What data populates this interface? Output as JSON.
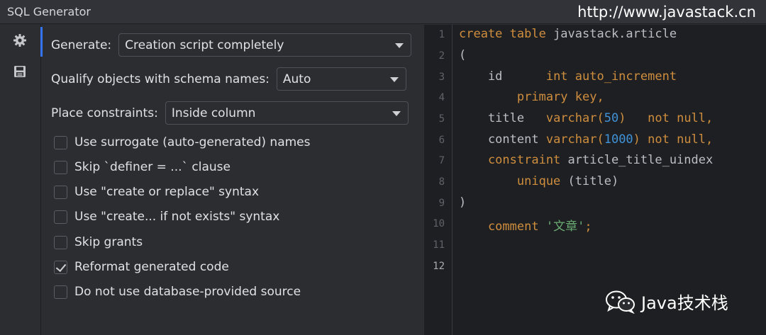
{
  "window": {
    "title": "SQL Generator"
  },
  "watermark": {
    "url": "http://www.javastack.cn",
    "wechat": "Java技术栈"
  },
  "toolstrip": {
    "items": [
      {
        "icon": "gear-icon"
      },
      {
        "icon": "save-icon"
      }
    ]
  },
  "settings": {
    "generate": {
      "label": "Generate:",
      "value": "Creation script completely"
    },
    "qualify": {
      "label": "Qualify objects with schema names:",
      "value": "Auto"
    },
    "constraints": {
      "label": "Place constraints:",
      "value": "Inside column"
    },
    "options": [
      {
        "label": "Use surrogate (auto-generated) names",
        "checked": false
      },
      {
        "label": "Skip `definer = ...` clause",
        "checked": false
      },
      {
        "label": "Use \"create or replace\" syntax",
        "checked": false
      },
      {
        "label": "Use \"create... if not exists\" syntax",
        "checked": false
      },
      {
        "label": "Skip grants",
        "checked": false
      },
      {
        "label": "Reformat generated code",
        "checked": true
      },
      {
        "label": "Do not use database-provided source",
        "checked": false
      }
    ]
  },
  "editor": {
    "line_numbers": [
      "1",
      "2",
      "3",
      "4",
      "5",
      "6",
      "7",
      "8",
      "9",
      "10",
      "11",
      "12"
    ],
    "current_line": "12",
    "code": {
      "l1_kw": "create table ",
      "l1_name": "javastack.article",
      "l2": "(",
      "l3_col": "    id      ",
      "l3_kw": "int auto_increment",
      "l4_kw": "        primary key,",
      "l5_col": "    title   ",
      "l5_kw": "varchar(",
      "l5_num": "50",
      "l5_kw2": ")   not null,",
      "l6_col": "    content ",
      "l6_kw": "varchar(",
      "l6_num": "1000",
      "l6_kw2": ") not null,",
      "l7_kw": "    constraint ",
      "l7_name": "article_title_uindex",
      "l8_kw": "        unique ",
      "l8_rest": "(title)",
      "l9": ")",
      "l10_kw": "    comment ",
      "l10_str": "'文章'",
      "l10_end": ";"
    }
  }
}
